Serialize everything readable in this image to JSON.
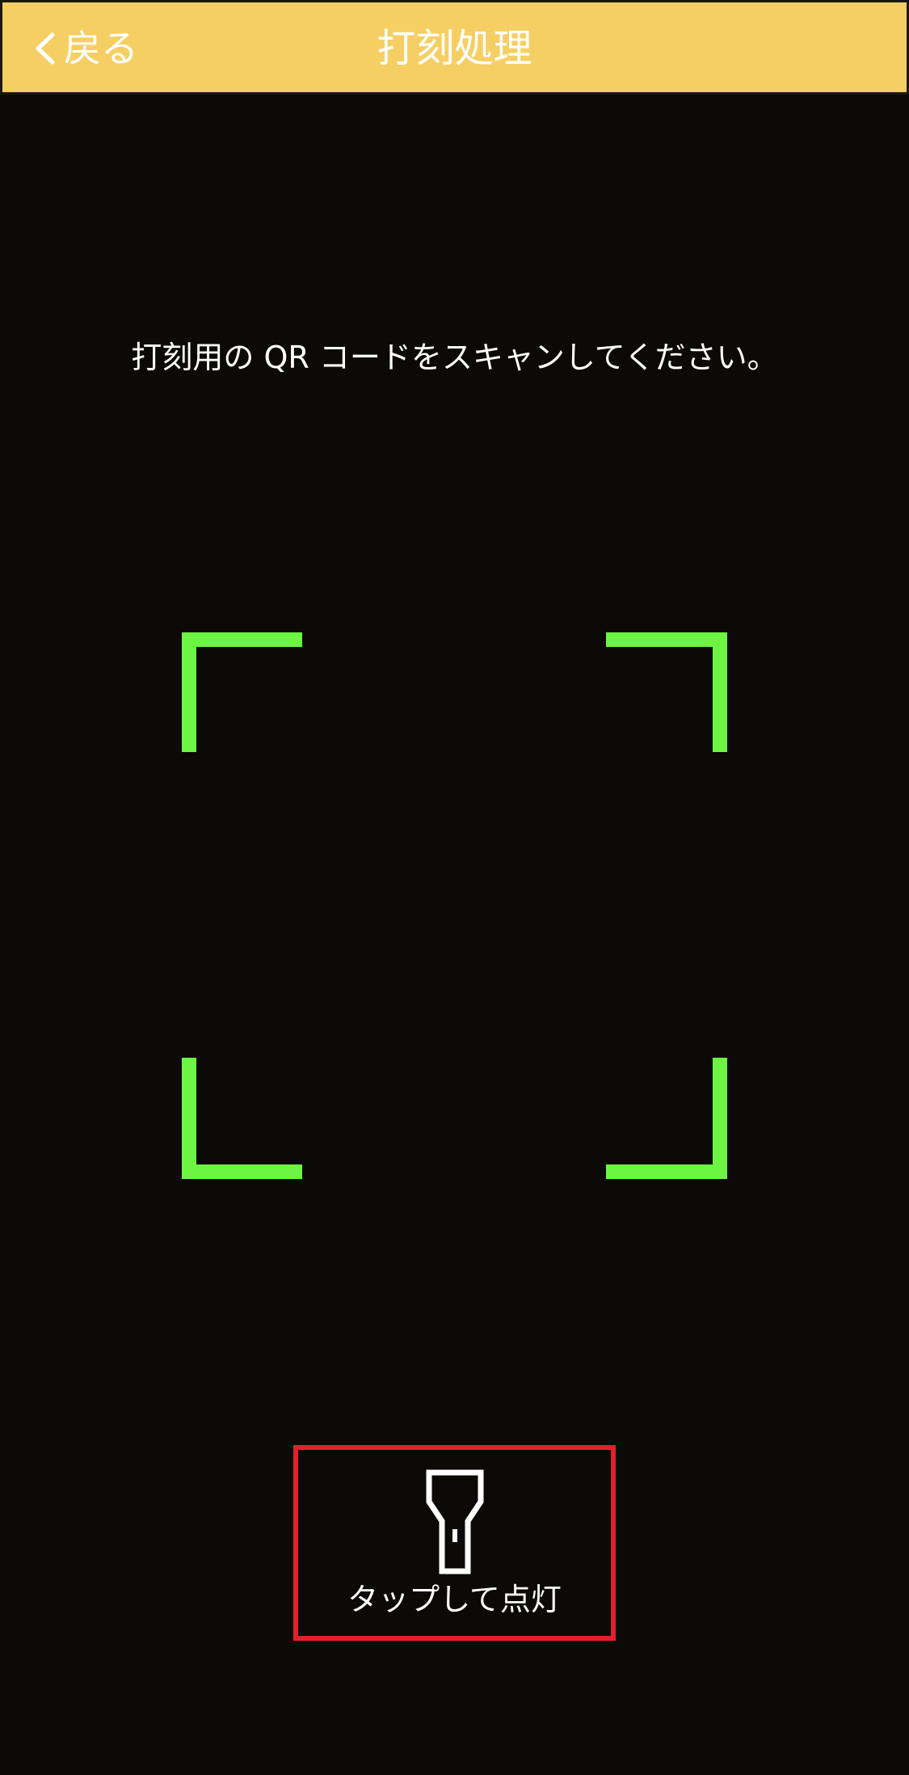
{
  "navbar": {
    "back_label": "戻る",
    "title": "打刻処理",
    "background_color": "#f6cf64"
  },
  "scanner": {
    "instruction": "打刻用の QR コードをスキャンしてください。",
    "frame_color": "#6cf542"
  },
  "torch": {
    "label": "タップして点灯",
    "border_color": "#e3202a",
    "icon": "flashlight-icon"
  }
}
